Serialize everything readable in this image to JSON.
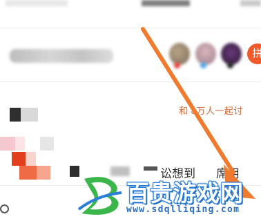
{
  "post": {
    "discussion_text": "和   8万人一起讨",
    "headline_text": "讼想到",
    "headline_tail": "席用",
    "follow_label": "拼"
  },
  "watermark": {
    "title": "百贵游戏网",
    "url": "www.sdqlliqing.com"
  },
  "annotation": {
    "arrow_color": "#f07a2e"
  }
}
